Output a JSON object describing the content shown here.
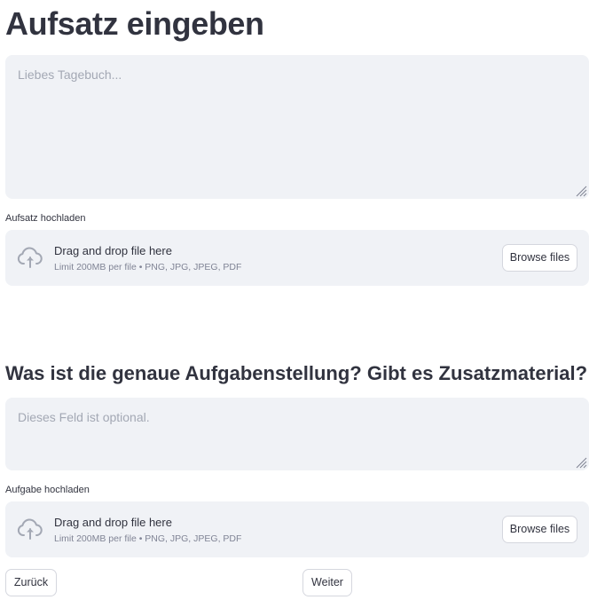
{
  "essay_section": {
    "title": "Aufsatz eingeben",
    "textarea_placeholder": "Liebes Tagebuch...",
    "upload_label": "Aufsatz hochladen",
    "dropzone": {
      "title": "Drag and drop file here",
      "hint": "Limit 200MB per file • PNG, JPG, JPEG, PDF",
      "button_label": "Browse files",
      "icon": "cloud-upload-icon"
    }
  },
  "task_section": {
    "title": "Was ist die genaue Aufgabenstellung? Gibt es Zusatzmaterial?",
    "textarea_placeholder": "Dieses Feld ist optional.",
    "upload_label": "Aufgabe hochladen",
    "dropzone": {
      "title": "Drag and drop file here",
      "hint": "Limit 200MB per file • PNG, JPG, JPEG, PDF",
      "button_label": "Browse files",
      "icon": "cloud-upload-icon"
    }
  },
  "navigation": {
    "back_label": "Zurück",
    "next_label": "Weiter"
  },
  "colors": {
    "text": "#31333f",
    "input_background": "#f0f2f6",
    "placeholder": "#a3a8b4",
    "hint": "#808495",
    "icon": "#a3a8b4",
    "button_border": "#d5d7de"
  }
}
